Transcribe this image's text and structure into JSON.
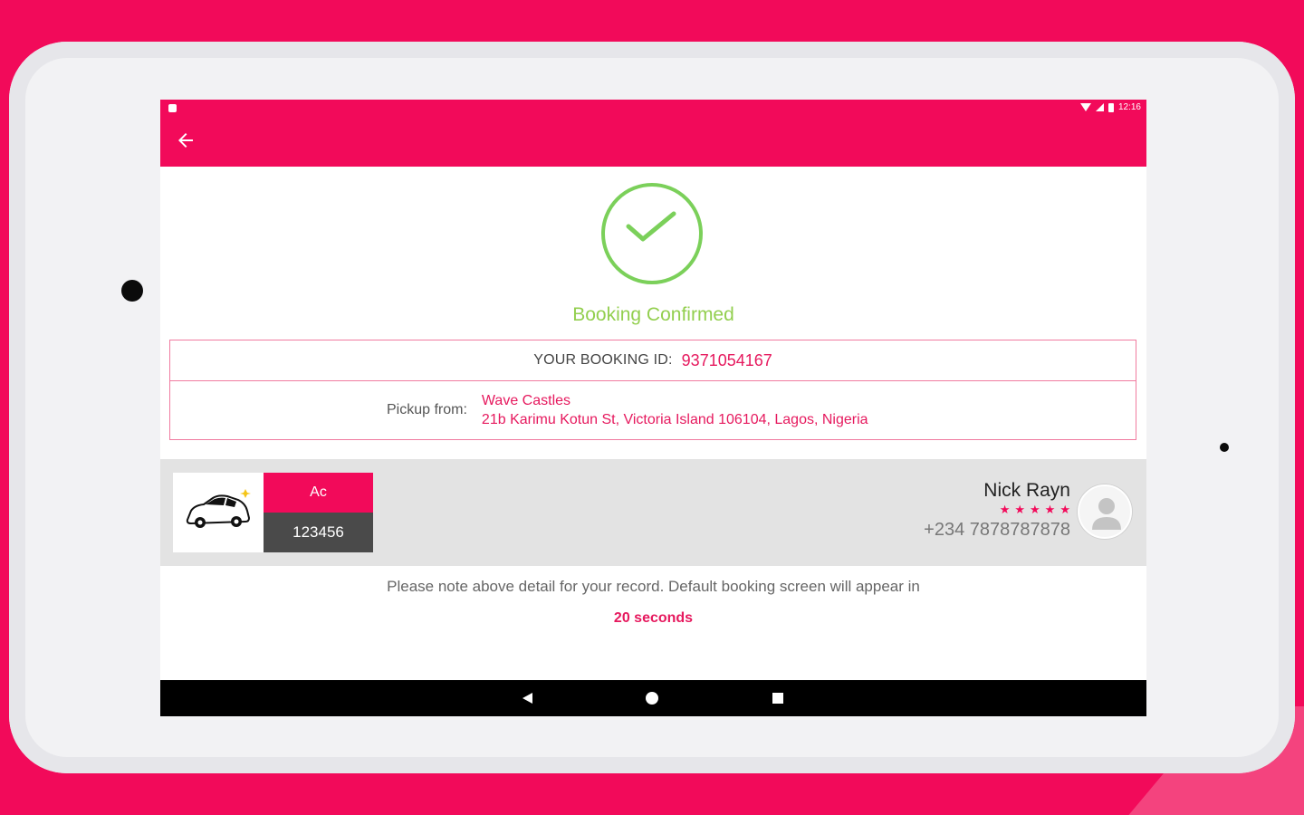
{
  "status_bar": {
    "time": "12:16"
  },
  "confirmation": {
    "title": "Booking Confirmed"
  },
  "booking": {
    "id_label": "YOUR BOOKING ID:",
    "id_value": "9371054167",
    "pickup_label": "Pickup from:",
    "pickup_place": "Wave Castles",
    "pickup_address": "21b Karimu Kotun St, Victoria Island 106104, Lagos, Nigeria"
  },
  "vehicle": {
    "type": "Ac",
    "plate": "123456"
  },
  "driver": {
    "name": "Nick Rayn",
    "rating": "★★★★★",
    "phone": "+234 7878787878"
  },
  "note": {
    "text": "Please note above detail for your record. Default booking screen will appear in",
    "countdown": "20 seconds"
  },
  "colors": {
    "accent": "#f20a5a",
    "success": "#7bd05a",
    "nav": "#000000"
  },
  "icons": [
    "back-arrow-icon",
    "check-icon",
    "car-icon",
    "user-icon",
    "wifi-icon",
    "signal-icon",
    "battery-icon"
  ]
}
